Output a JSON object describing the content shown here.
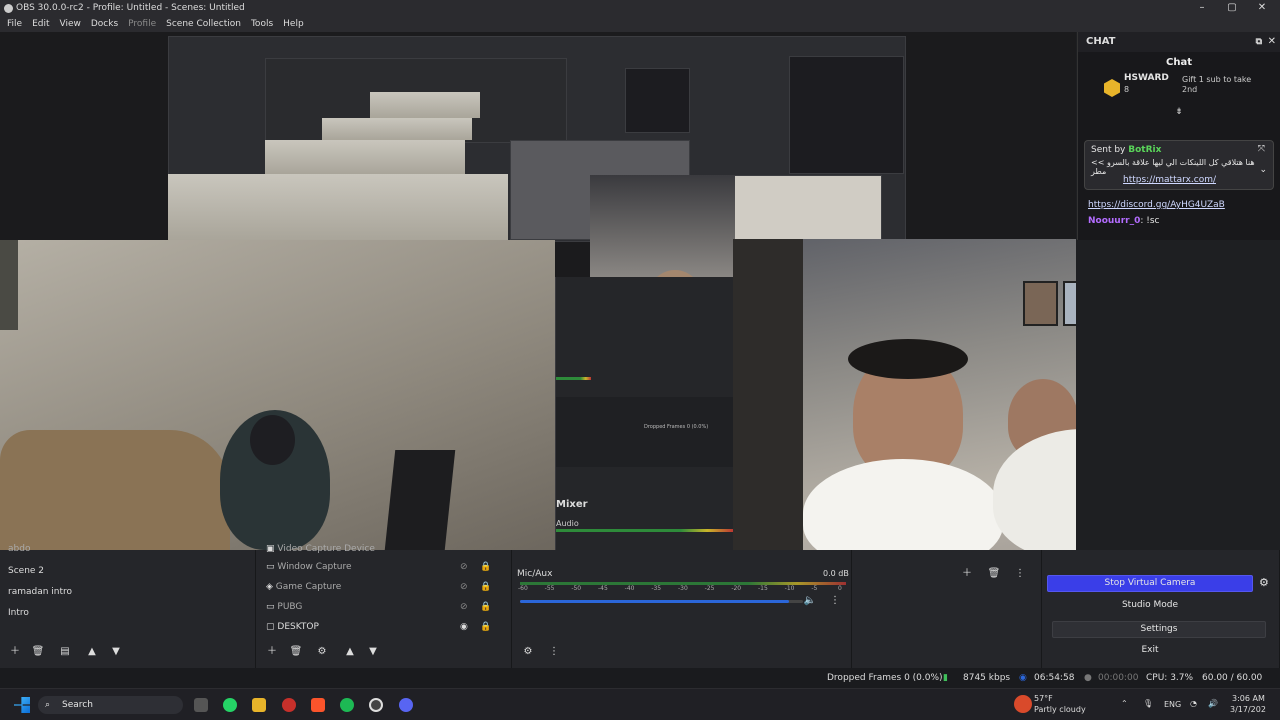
{
  "window": {
    "title": "OBS 30.0.0-rc2 - Profile: Untitled - Scenes: Untitled",
    "minimize": "–",
    "maximize": "▢",
    "close": "✕"
  },
  "menu": [
    "File",
    "Edit",
    "View",
    "Docks",
    "Profile",
    "Scene Collection",
    "Tools",
    "Help"
  ],
  "chat": {
    "dock_title": "CHAT",
    "title": "Chat",
    "gift_user": "HSWARD",
    "gift_count": "8",
    "gift_text": "Gift 1 sub to take 2nd",
    "pinned_prefix": "Sent by",
    "pinned_user": "BotRix",
    "pinned_message": "هنا هتلاقي كل اللينكات الي ليها علاقة بالسرو >> مطر",
    "pinned_link": "https://mattarx.com/",
    "discord_link": "https://discord.gg/AyHG4UZaB",
    "user2": "Noouurr_0",
    "user2_msg": ": !sc"
  },
  "preview": {
    "mixer_label": "Mixer",
    "audio_label": "Audio",
    "dropped_inner": "Dropped Frames 0 (0.0%)"
  },
  "scenes": {
    "items": [
      "abdo",
      "Scene 2",
      "ramadan intro",
      "Intro"
    ]
  },
  "sources": {
    "items": [
      {
        "name": "Video Capture Device",
        "icon": "camera-icon"
      },
      {
        "name": "Window Capture",
        "icon": "window-icon"
      },
      {
        "name": "Game Capture",
        "icon": "gamepad-icon"
      },
      {
        "name": "PUBG",
        "icon": "window-icon"
      },
      {
        "name": "DESKTOP",
        "icon": "monitor-icon"
      }
    ]
  },
  "mixer": {
    "channel": "Mic/Aux",
    "db": "0.0 dB",
    "ticks": [
      "-60",
      "-55",
      "-50",
      "-45",
      "-40",
      "-35",
      "-30",
      "-25",
      "-20",
      "-15",
      "-10",
      "-5",
      "0"
    ],
    "volume_level": 0.95
  },
  "controls": {
    "stop_virtual_camera": "Stop Virtual Camera",
    "studio_mode": "Studio Mode",
    "settings": "Settings",
    "exit": "Exit"
  },
  "status": {
    "dropped_frames": "Dropped Frames 0 (0.0%)",
    "bitrate": "8745 kbps",
    "live_time": "06:54:58",
    "rec_time": "00:00:00",
    "cpu": "CPU: 3.7%",
    "fps": "60.00 / 60.00 FPS"
  },
  "taskbar": {
    "search": "Search",
    "weather_temp": "57°F",
    "weather_desc": "Partly cloudy",
    "lang": "ENG",
    "time": "3:06 AM",
    "date": "3/17/202"
  },
  "colors": {
    "accent": "#3a3ee8",
    "record_on": "#2b66d9"
  }
}
